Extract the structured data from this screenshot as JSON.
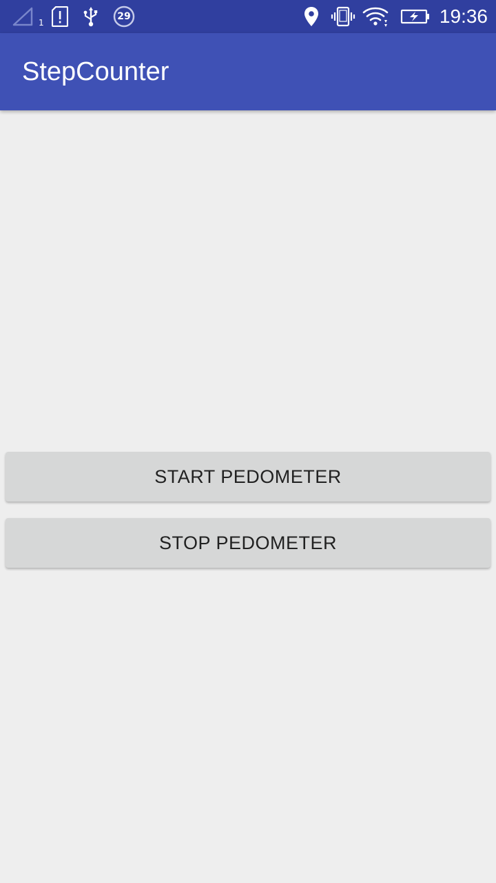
{
  "status_bar": {
    "sim_number": "1",
    "notification_badge": "29",
    "time": "19:36",
    "icons": [
      "signal-icon",
      "alert-icon",
      "usb-icon",
      "badge-icon",
      "location-icon",
      "vibrate-icon",
      "wifi-icon",
      "battery-icon"
    ]
  },
  "app_bar": {
    "title": "StepCounter",
    "color": "#3F51B5",
    "status_color": "#303F9F"
  },
  "buttons": {
    "start_label": "START PEDOMETER",
    "stop_label": "STOP PEDOMETER"
  }
}
